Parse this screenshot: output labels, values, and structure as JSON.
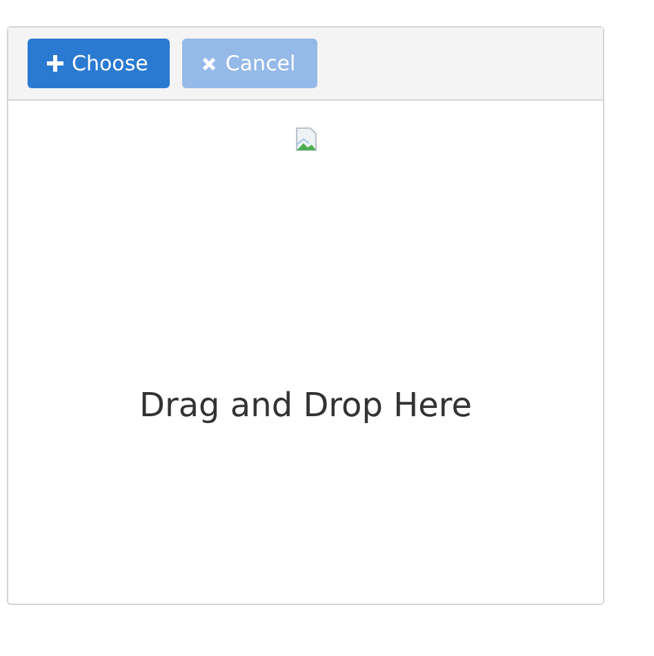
{
  "toolbar": {
    "buttons": [
      {
        "kind": "choose",
        "label": "Choose",
        "disabled": false
      },
      {
        "kind": "cancel",
        "label": "Cancel",
        "disabled": true
      }
    ]
  },
  "dropzone": {
    "message": "Drag and Drop Here"
  }
}
